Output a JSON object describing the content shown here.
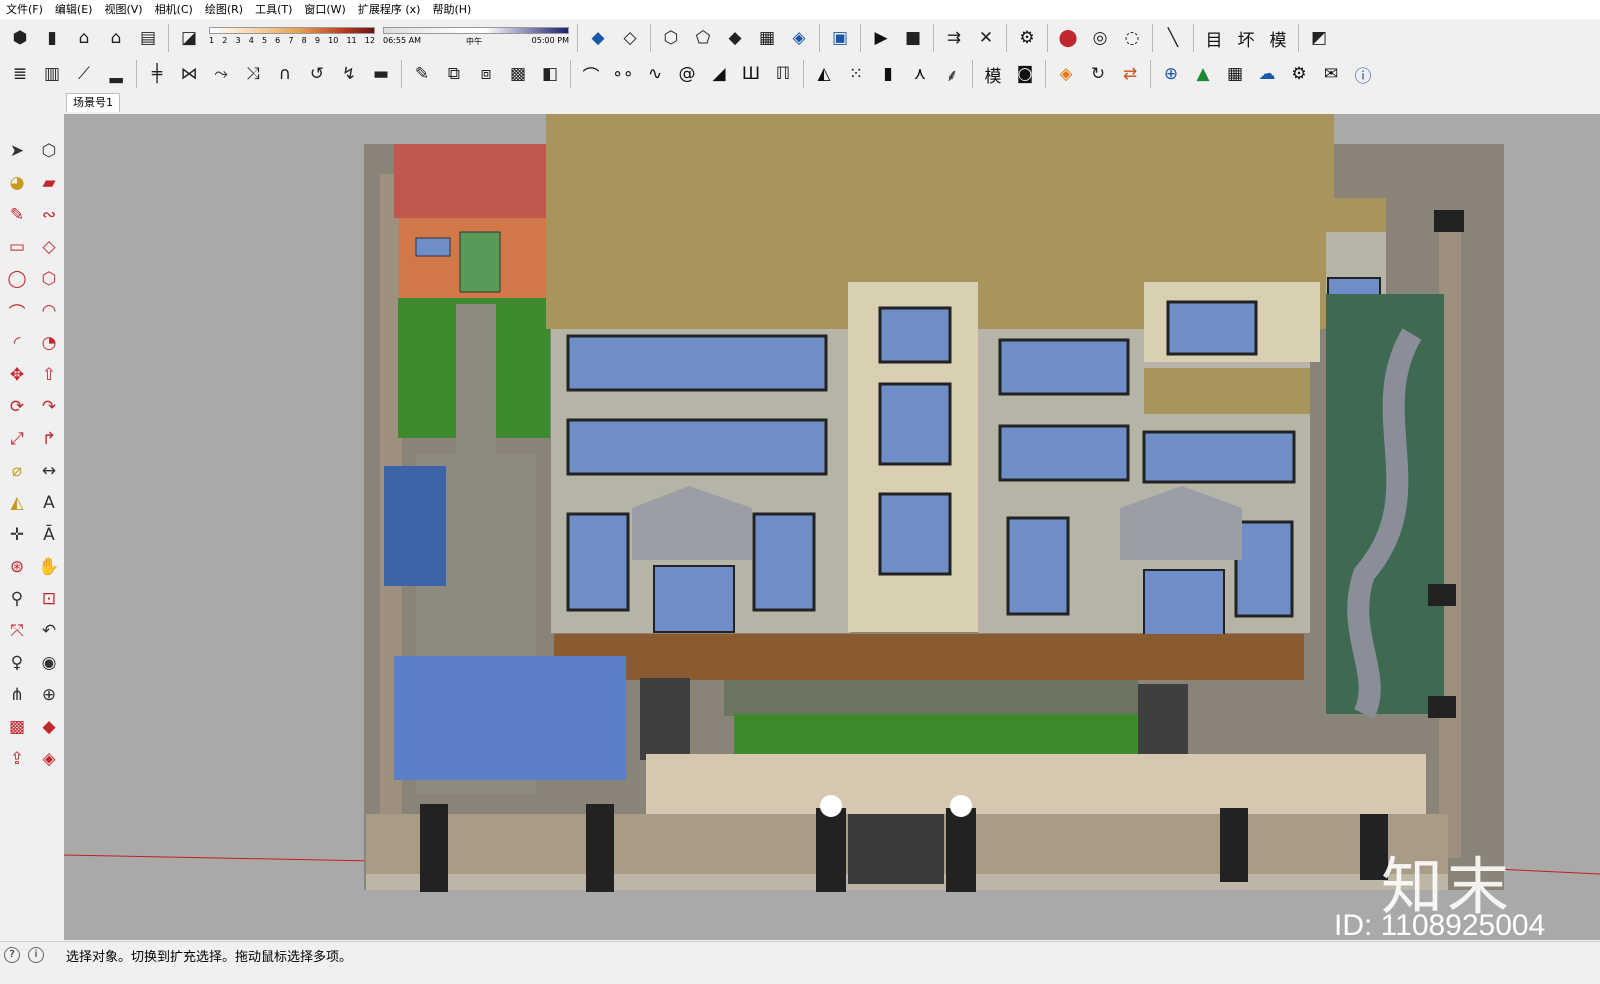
{
  "menubar": {
    "items": [
      "文件(F)",
      "编辑(E)",
      "视图(V)",
      "相机(C)",
      "绘图(R)",
      "工具(T)",
      "窗口(W)",
      "扩展程序 (x)",
      "帮助(H)"
    ]
  },
  "toolbar_top": {
    "shadow_scale": [
      "1",
      "2",
      "3",
      "4",
      "5",
      "6",
      "7",
      "8",
      "9",
      "10",
      "11",
      "12"
    ],
    "time_start": "06:55 AM",
    "time_mid": "中午",
    "time_end": "05:00 PM",
    "text_buttons": [
      "目",
      "坏",
      "模"
    ],
    "text_buttons_2": [
      "模"
    ]
  },
  "scene_tabs": [
    "场景号1"
  ],
  "status": {
    "message": "选择对象。切换到扩充选择。拖动鼠标选择多项。",
    "icon_a": "?",
    "icon_b": "i"
  },
  "watermark": {
    "brand": "知末",
    "id": "ID: 1108925004"
  },
  "colors": {
    "viewport_bg": "#a9a9a9",
    "roof": "#a8955d",
    "wall": "#b6b4a6",
    "window": "#6f8ec9",
    "grass": "#3d8a2f",
    "deck": "#8a5a30"
  }
}
